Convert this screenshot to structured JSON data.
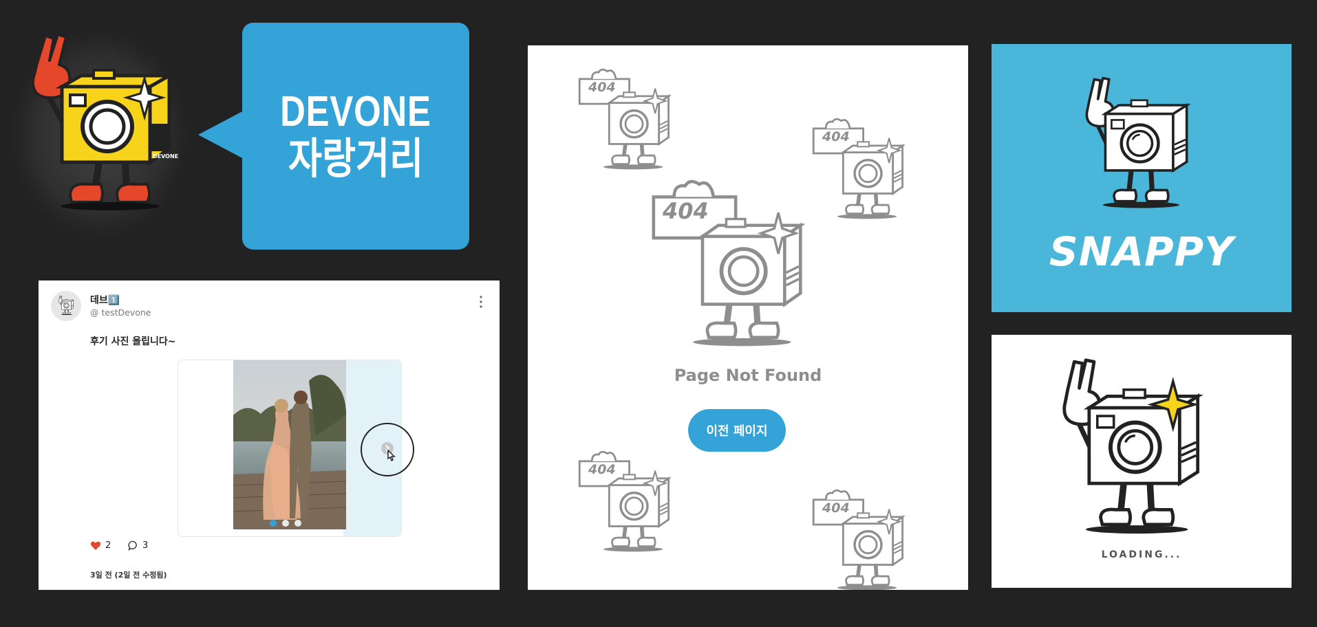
{
  "bubble": {
    "brand": "DEVONE",
    "title": "자랑거리"
  },
  "mascot": {
    "brand_label": "DEVONE"
  },
  "post": {
    "user_name": "데브1️⃣",
    "user_handle": "@ testDevone",
    "text": "후기 사진 올립니다~",
    "likes": "2",
    "comments": "3",
    "time": "3일 전 (2일 전 수정됨)"
  },
  "not_found": {
    "sign": "404",
    "title": "Page Not Found",
    "button": "이전 페이지"
  },
  "snappy": {
    "title": "SNAPPY"
  },
  "loading": {
    "text": "LOADING..."
  },
  "colors": {
    "accent": "#33a3d8",
    "background": "#222222",
    "heart": "#e34a2f"
  }
}
